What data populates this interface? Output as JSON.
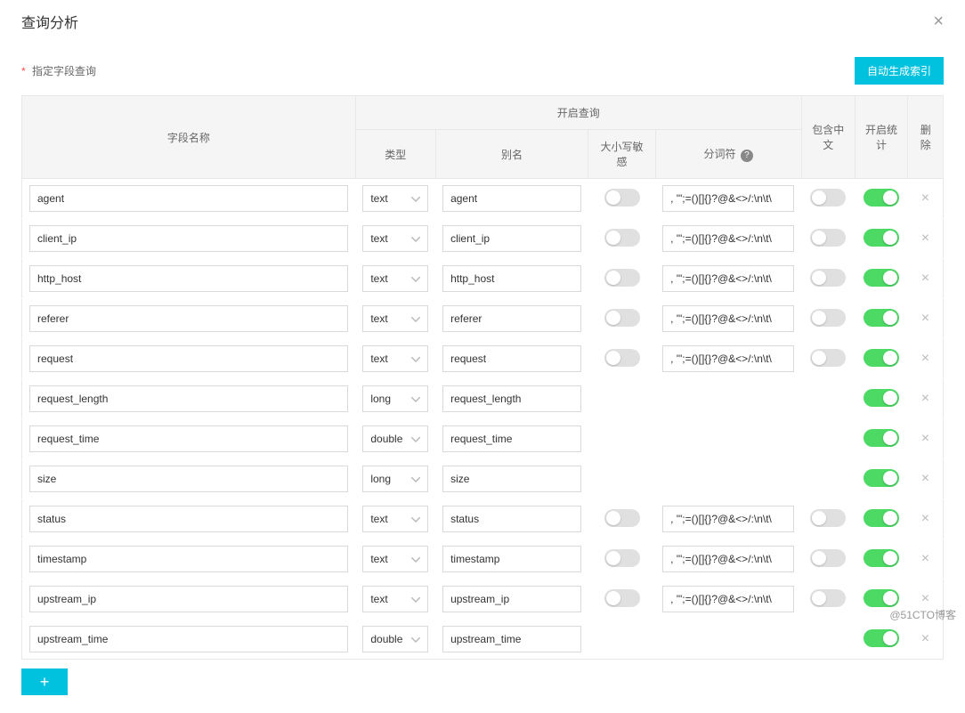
{
  "modal": {
    "title": "查询分析",
    "required_label": "指定字段查询",
    "auto_index_button": "自动生成索引"
  },
  "table": {
    "headers": {
      "field_name": "字段名称",
      "open_query": "开启查询",
      "type": "类型",
      "alias": "别名",
      "case_sensitive": "大小写敏感",
      "tokenizer": "分词符",
      "include_chinese": "包含中文",
      "open_stats": "开启统计",
      "delete": "删除"
    },
    "rows": [
      {
        "field": "agent",
        "type": "text",
        "alias": "agent",
        "case_sensitive": false,
        "tokenizer": ", '\";=()[]{}?@&<>/:\\n\\t\\",
        "include_chinese": false,
        "stats": true,
        "show_case": true,
        "show_tok": true,
        "show_zh": true
      },
      {
        "field": "client_ip",
        "type": "text",
        "alias": "client_ip",
        "case_sensitive": false,
        "tokenizer": ", '\";=()[]{}?@&<>/:\\n\\t\\",
        "include_chinese": false,
        "stats": true,
        "show_case": true,
        "show_tok": true,
        "show_zh": true
      },
      {
        "field": "http_host",
        "type": "text",
        "alias": "http_host",
        "case_sensitive": false,
        "tokenizer": ", '\";=()[]{}?@&<>/:\\n\\t\\",
        "include_chinese": false,
        "stats": true,
        "show_case": true,
        "show_tok": true,
        "show_zh": true
      },
      {
        "field": "referer",
        "type": "text",
        "alias": "referer",
        "case_sensitive": false,
        "tokenizer": ", '\";=()[]{}?@&<>/:\\n\\t\\",
        "include_chinese": false,
        "stats": true,
        "show_case": true,
        "show_tok": true,
        "show_zh": true
      },
      {
        "field": "request",
        "type": "text",
        "alias": "request",
        "case_sensitive": false,
        "tokenizer": ", '\";=()[]{}?@&<>/:\\n\\t\\",
        "include_chinese": false,
        "stats": true,
        "show_case": true,
        "show_tok": true,
        "show_zh": true
      },
      {
        "field": "request_length",
        "type": "long",
        "alias": "request_length",
        "case_sensitive": null,
        "tokenizer": null,
        "include_chinese": null,
        "stats": true,
        "show_case": false,
        "show_tok": false,
        "show_zh": false
      },
      {
        "field": "request_time",
        "type": "double",
        "alias": "request_time",
        "case_sensitive": null,
        "tokenizer": null,
        "include_chinese": null,
        "stats": true,
        "show_case": false,
        "show_tok": false,
        "show_zh": false
      },
      {
        "field": "size",
        "type": "long",
        "alias": "size",
        "case_sensitive": null,
        "tokenizer": null,
        "include_chinese": null,
        "stats": true,
        "show_case": false,
        "show_tok": false,
        "show_zh": false
      },
      {
        "field": "status",
        "type": "text",
        "alias": "status",
        "case_sensitive": false,
        "tokenizer": ", '\";=()[]{}?@&<>/:\\n\\t\\",
        "include_chinese": false,
        "stats": true,
        "show_case": true,
        "show_tok": true,
        "show_zh": true
      },
      {
        "field": "timestamp",
        "type": "text",
        "alias": "timestamp",
        "case_sensitive": false,
        "tokenizer": ", '\";=()[]{}?@&<>/:\\n\\t\\",
        "include_chinese": false,
        "stats": true,
        "show_case": true,
        "show_tok": true,
        "show_zh": true
      },
      {
        "field": "upstream_ip",
        "type": "text",
        "alias": "upstream_ip",
        "case_sensitive": false,
        "tokenizer": ", '\";=()[]{}?@&<>/:\\n\\t\\",
        "include_chinese": false,
        "stats": true,
        "show_case": true,
        "show_tok": true,
        "show_zh": true
      },
      {
        "field": "upstream_time",
        "type": "double",
        "alias": "upstream_time",
        "case_sensitive": null,
        "tokenizer": null,
        "include_chinese": null,
        "stats": true,
        "show_case": false,
        "show_tok": false,
        "show_zh": false
      }
    ]
  },
  "add_button": "+",
  "watermark": "@51CTO博客"
}
